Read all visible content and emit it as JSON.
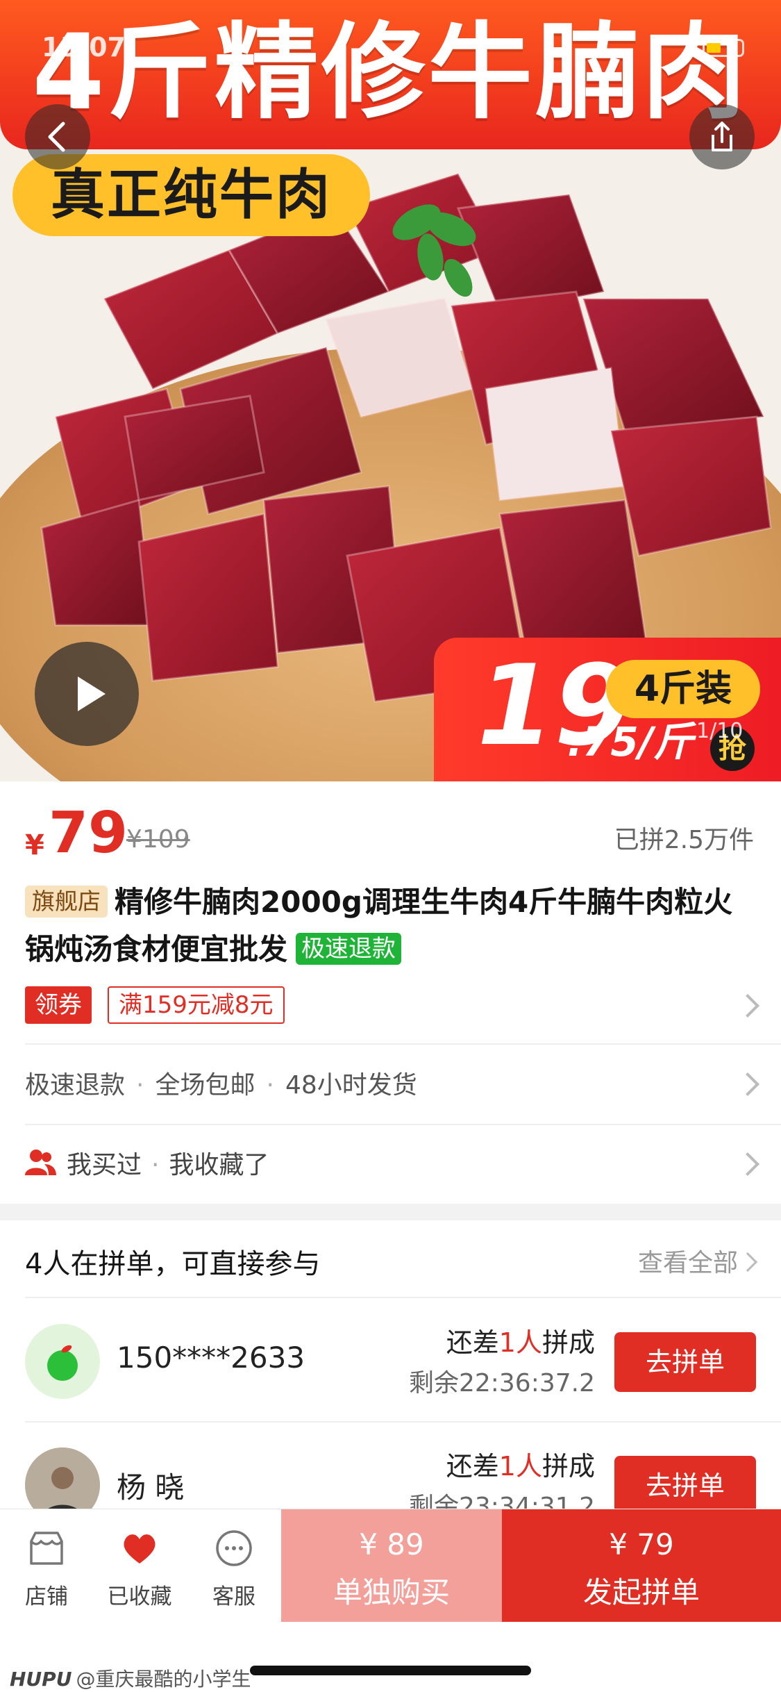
{
  "status": {
    "time": "15:07"
  },
  "hero": {
    "banner_text": "4斤精修牛腩肉",
    "pill_text": "真正纯牛肉",
    "price_big": "19",
    "price_unit": ".75/斤",
    "pack": "4斤装",
    "grab": "抢",
    "counter": "1/10"
  },
  "price": {
    "yen": "¥",
    "now": "79",
    "old": "¥109",
    "sold": "已拼2.5万件"
  },
  "title": {
    "flag": "旗舰店",
    "text": "精修牛腩肉2000g调理生牛肉4斤牛腩牛肉粒火锅炖汤食材便宜批发",
    "refund_tag": "极速退款"
  },
  "coupon": {
    "button": "领券",
    "tag": "满159元减8元"
  },
  "services": [
    "极速退款",
    "全场包邮",
    "48小时发货"
  ],
  "favorites": [
    "我买过",
    "我收藏了"
  ],
  "group": {
    "title": "4人在拼单，可直接参与",
    "view_all": "查看全部",
    "items": [
      {
        "name": "150****2633",
        "lack_prefix": "还差",
        "lack_count": "1人",
        "lack_suffix": "拼成",
        "remain": "剩余22:36:37.2",
        "button": "去拼单"
      },
      {
        "name": "杨 晓",
        "lack_prefix": "还差",
        "lack_count": "1人",
        "lack_suffix": "拼成",
        "remain": "剩余23:34:31.2",
        "button": "去拼单"
      }
    ]
  },
  "bottom": {
    "tabs": [
      {
        "label": "店铺",
        "icon": "store-icon"
      },
      {
        "label": "已收藏",
        "icon": "heart-icon"
      },
      {
        "label": "客服",
        "icon": "chat-icon"
      }
    ],
    "solo_price": "¥ 89",
    "solo_label": "单独购买",
    "group_price": "¥ 79",
    "group_label": "发起拼单"
  },
  "watermark": {
    "brand": "HUPU",
    "handle": "@重庆最酷的小学生"
  },
  "colors": {
    "accent": "#e02e24",
    "solo": "#f3a09b",
    "green": "#1fb337",
    "banner": "#ff5a1f",
    "pill": "#ffc02a"
  }
}
